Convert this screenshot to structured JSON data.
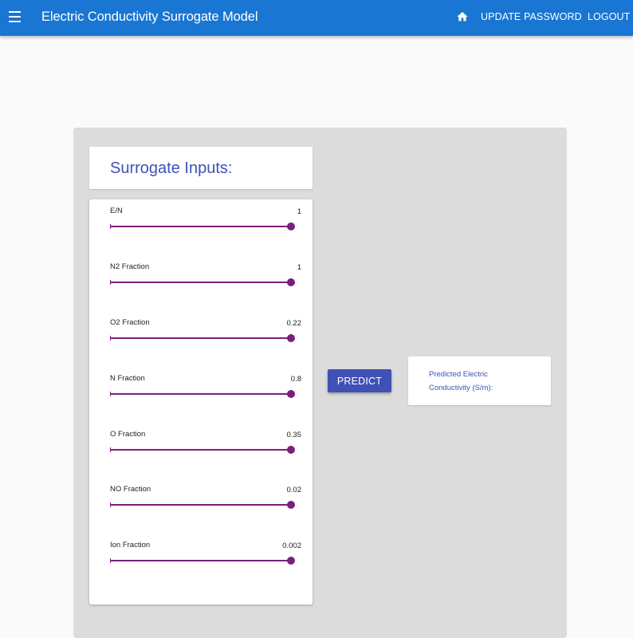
{
  "appbar": {
    "title": "Electric Conductivity Surrogate Model",
    "icons": {
      "menu": "menu-icon",
      "home": "home-icon"
    },
    "nav": {
      "update_password": "UPDATE PASSWORD",
      "logout": "LOGOUT"
    }
  },
  "inputs": {
    "title": "Surrogate Inputs:",
    "sliders": [
      {
        "label": "E/N",
        "value": "1",
        "level": 1.0
      },
      {
        "label": "N2 Fraction",
        "value": "1",
        "level": 1.0
      },
      {
        "label": "O2 Fraction",
        "value": "0.22",
        "level": 1.0
      },
      {
        "label": "N Fraction",
        "value": "0.8",
        "level": 1.0
      },
      {
        "label": "O Fraction",
        "value": "0.35",
        "level": 1.0
      },
      {
        "label": "NO Fraction",
        "value": "0.02",
        "level": 1.0
      },
      {
        "label": "Ion Fraction",
        "value": "0.002",
        "level": 1.0
      }
    ]
  },
  "predict": {
    "label": "PREDICT"
  },
  "result": {
    "label": "Predicted Electric Conductivity (S/m):"
  },
  "colors": {
    "appbar": "#1976d2",
    "primary": "#3f51b5",
    "slider": "#7b1f7b",
    "card_background": "#dcdcdc",
    "page_background": "#fafafa"
  }
}
